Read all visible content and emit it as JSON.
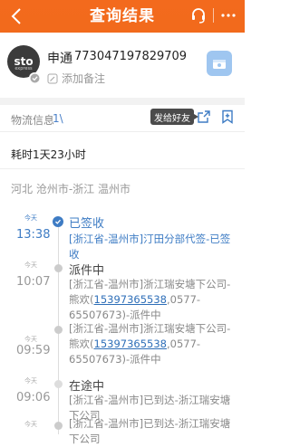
{
  "header": {
    "title": "查询结果"
  },
  "card": {
    "logo_text": "sto",
    "logo_sub": "express",
    "company": "申通",
    "tracking_number": "773047197829709",
    "note_label": "添加备注"
  },
  "info": {
    "label": "物流信息",
    "separator": "1\\",
    "send_friend_label": "发给好友"
  },
  "elapsed": "耗时1天23小时",
  "route": "河北 沧州市-浙江 温州市",
  "events": [
    {
      "day": "今天",
      "time": "13:38",
      "status": "已签收",
      "desc_before": "[浙江省-温州市]汀田分部代签-已签收",
      "phone": "",
      "desc_after": ""
    },
    {
      "day": "今天",
      "time": "10:07",
      "status": "派件中",
      "desc_before": "[浙江省-温州市]浙江瑞安塘下公司-熊欢(",
      "phone": "15397365538",
      "desc_after": ",0577-65507673)-派件中"
    },
    {
      "day": "今天",
      "time": "09:59",
      "status": "",
      "desc_before": "[浙江省-温州市]浙江瑞安塘下公司-熊欢(",
      "phone": "15397365538",
      "desc_after": ",0577-65507673)-派件中"
    },
    {
      "day": "今天",
      "time": "09:06",
      "status": "在途中",
      "desc_before": "[浙江省-温州市]已到达-浙江瑞安塘下公司",
      "phone": "",
      "desc_after": ""
    },
    {
      "day": "今天",
      "time": "",
      "status": "",
      "desc_before": "[浙江省-温州市]已到达-浙江瑞安塘下公司",
      "phone": "",
      "desc_after": ""
    }
  ],
  "colors": {
    "brand": "#f26a1c",
    "accent": "#3e7cc4"
  }
}
